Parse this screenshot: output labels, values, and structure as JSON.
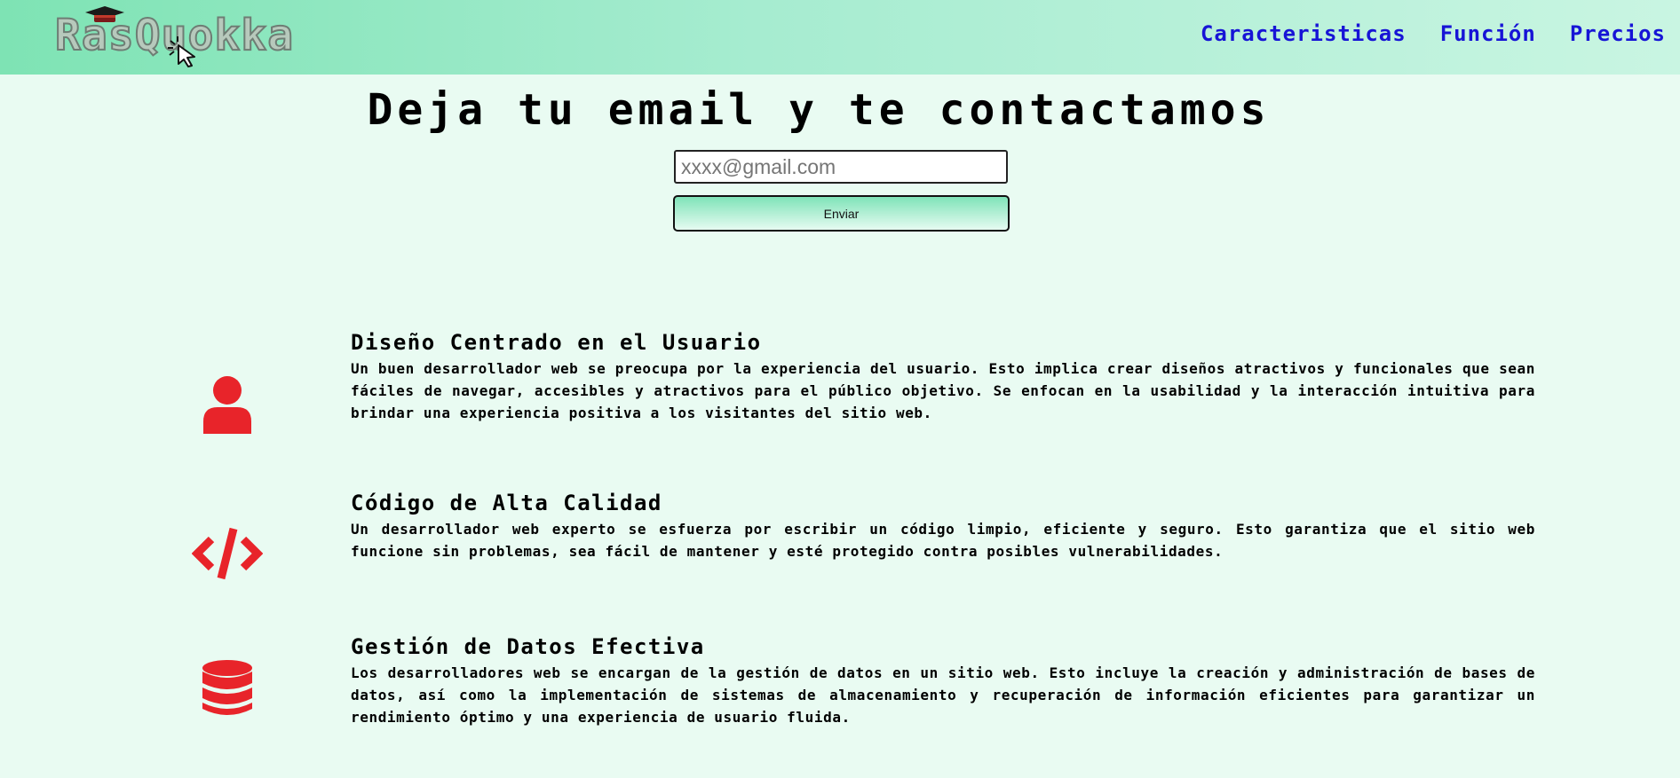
{
  "header": {
    "logo_text": "RasQuokka",
    "nav": [
      {
        "label": "Caracteristicas"
      },
      {
        "label": "Función"
      },
      {
        "label": "Precios"
      }
    ]
  },
  "hero": {
    "title": "Deja tu email y te contactamos",
    "email_placeholder": "xxxx@gmail.com",
    "send_label": "Enviar"
  },
  "features": [
    {
      "icon": "user-icon",
      "title": "Diseño Centrado en el Usuario",
      "text": "Un buen desarrollador web se preocupa por la experiencia del usuario. Esto implica crear diseños atractivos y funcionales que sean fáciles de navegar, accesibles y atractivos para el público objetivo. Se enfocan en la usabilidad y la interacción intuitiva para brindar una experiencia positiva a los visitantes del sitio web."
    },
    {
      "icon": "code-icon",
      "title": "Código de Alta Calidad",
      "text": "Un desarrollador web experto se esfuerza por escribir un código limpio, eficiente y seguro. Esto garantiza que el sitio web funcione sin problemas, sea fácil de mantener y esté protegido contra posibles vulnerabilidades."
    },
    {
      "icon": "database-icon",
      "title": "Gestión de Datos Efectiva",
      "text": "Los desarrolladores web se encargan de la gestión de datos en un sitio web. Esto incluye la creación y administración de bases de datos, así como la implementación de sistemas de almacenamiento y recuperación de información eficientes para garantizar un rendimiento óptimo y una experiencia de usuario fluida."
    }
  ],
  "colors": {
    "accent_icon": "#e8242a",
    "nav_link": "#1714d6",
    "header_gradient_start": "#7ee3b4",
    "page_background": "#e9fbf2"
  }
}
